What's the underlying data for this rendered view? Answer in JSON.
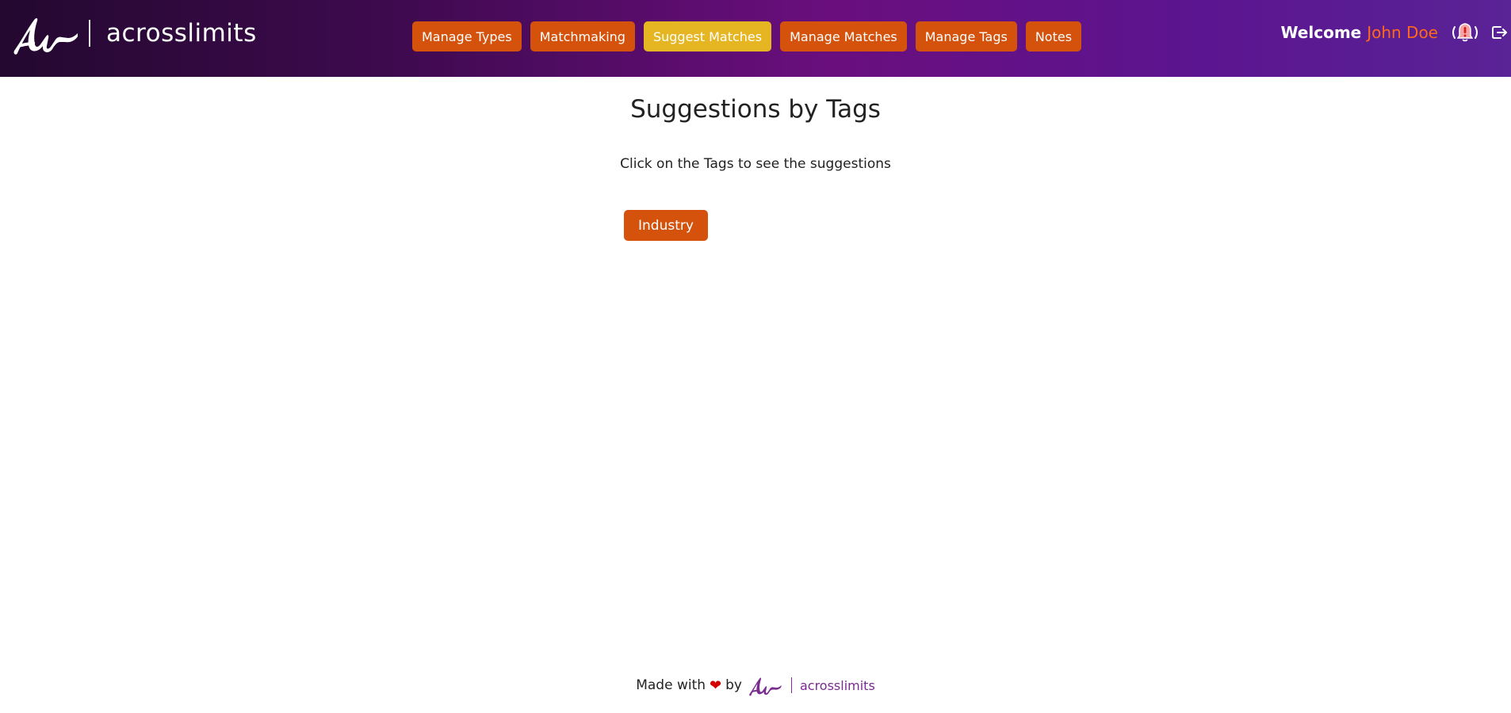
{
  "brand": {
    "name": "acrosslimits",
    "logo_icon": "ar-script-logo-icon"
  },
  "nav": {
    "items": [
      {
        "label": "Manage Types",
        "active": false
      },
      {
        "label": "Matchmaking",
        "active": false
      },
      {
        "label": "Suggest Matches",
        "active": true
      },
      {
        "label": "Manage Matches",
        "active": false
      },
      {
        "label": "Manage Tags",
        "active": false
      },
      {
        "label": "Notes",
        "active": false
      }
    ],
    "button_color": "#d4520b",
    "active_color": "#e5b622"
  },
  "user": {
    "welcome_label": "Welcome",
    "name": "John Doe",
    "name_color": "#ff6a1a",
    "notification_icon": "alert-bell-icon",
    "logout_icon": "logout-icon"
  },
  "main": {
    "title": "Suggestions by Tags",
    "subtitle": "Click on the Tags to see the suggestions",
    "tags": [
      {
        "label": "Industry"
      }
    ]
  },
  "footer": {
    "made_with": "Made with",
    "heart_icon": "heart-icon",
    "by": "by",
    "brand_name": "acrosslimits"
  }
}
